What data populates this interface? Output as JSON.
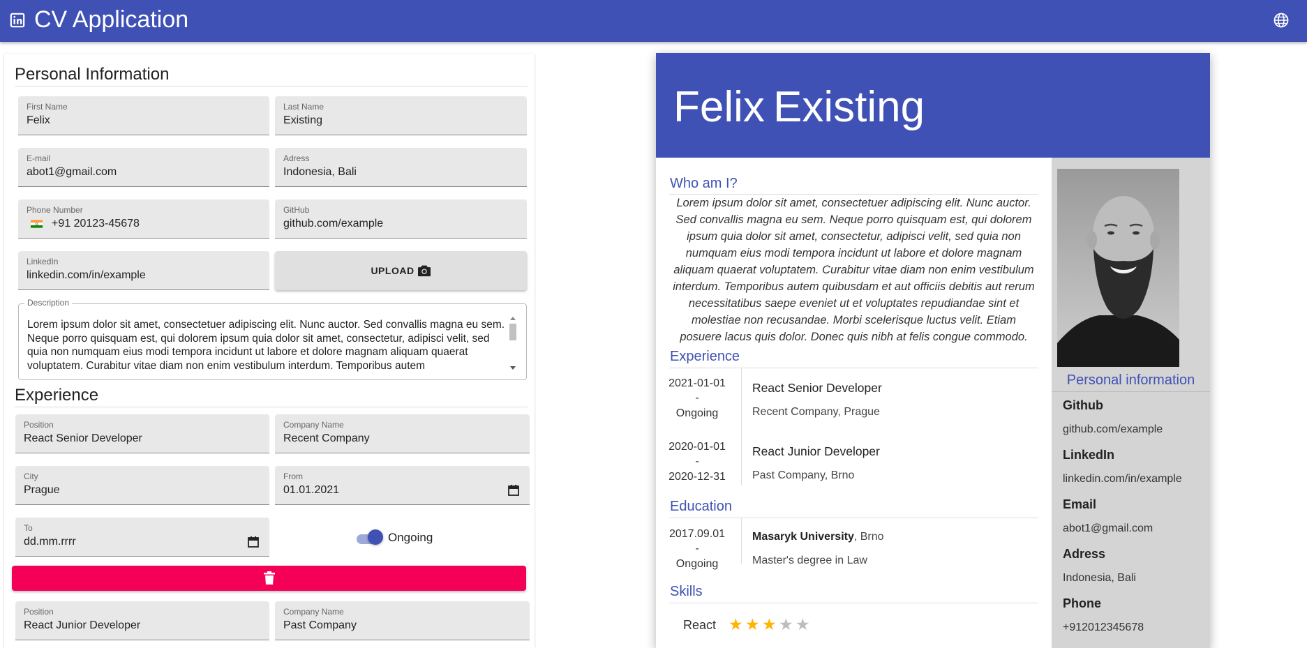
{
  "app": {
    "title": "CV Application"
  },
  "form": {
    "personal": {
      "title": "Personal Information",
      "first_name": {
        "label": "First Name",
        "value": "Felix"
      },
      "last_name": {
        "label": "Last Name",
        "value": "Existing"
      },
      "email": {
        "label": "E-mail",
        "value": "abot1@gmail.com"
      },
      "address": {
        "label": "Adress",
        "value": "Indonesia, Bali"
      },
      "phone": {
        "label": "Phone Number",
        "value": "+91 20123-45678",
        "flag": "india-flag-icon"
      },
      "github": {
        "label": "GitHub",
        "value": "github.com/example"
      },
      "linkedin": {
        "label": "LinkedIn",
        "value": "linkedin.com/in/example"
      },
      "upload_label": "UPLOAD",
      "description": {
        "label": "Description",
        "value": "Lorem ipsum dolor sit amet, consectetuer adipiscing elit. Nunc auctor. Sed convallis magna eu sem. Neque porro quisquam est, qui dolorem ipsum quia dolor sit amet, consectetur, adipisci velit, sed quia non numquam eius modi tempora incidunt ut labore et dolore magnam aliquam quaerat voluptatem. Curabitur vitae diam non enim vestibulum interdum. Temporibus autem"
      }
    },
    "experience": {
      "title": "Experience",
      "items": [
        {
          "position": {
            "label": "Position",
            "value": "React Senior Developer"
          },
          "company": {
            "label": "Company Name",
            "value": "Recent Company"
          },
          "city": {
            "label": "City",
            "value": "Prague"
          },
          "from": {
            "label": "From",
            "value": "01.01.2021"
          },
          "to": {
            "label": "To",
            "value": "dd.mm.rrrr"
          },
          "ongoing_label": "Ongoing",
          "ongoing": true
        },
        {
          "position": {
            "label": "Position",
            "value": "React Junior Developer"
          },
          "company": {
            "label": "Company Name",
            "value": "Past Company"
          }
        }
      ]
    }
  },
  "cv": {
    "first_name": "Felix",
    "last_name": "Existing",
    "about_title": "Who am I?",
    "about": "Lorem ipsum dolor sit amet, consectetuer adipiscing elit. Nunc auctor. Sed convallis magna eu sem. Neque porro quisquam est, qui dolorem ipsum quia dolor sit amet, consectetur, adipisci velit, sed quia non numquam eius modi tempora incidunt ut labore et dolore magnam aliquam quaerat voluptatem. Curabitur vitae diam non enim vestibulum interdum. Temporibus autem quibusdam et aut officiis debitis aut rerum necessitatibus saepe eveniet ut et voluptates repudiandae sint et molestiae non recusandae. Morbi scelerisque luctus velit. Etiam posuere lacus quis dolor. Donec quis nibh at felis congue commodo.",
    "experience_title": "Experience",
    "experience": [
      {
        "from": "2021-01-01",
        "sep": "-",
        "to": "Ongoing",
        "title": "React Senior Developer",
        "place": "Recent Company, Prague"
      },
      {
        "from": "2020-01-01",
        "sep": "-",
        "to": "2020-12-31",
        "title": "React Junior Developer",
        "place": "Past Company, Brno"
      }
    ],
    "education_title": "Education",
    "education": [
      {
        "from": "2017.09.01",
        "sep": "-",
        "to": "Ongoing",
        "school": "Masaryk University",
        "city": ", Brno",
        "degree": "Master's degree in Law"
      }
    ],
    "skills_title": "Skills",
    "skills": [
      {
        "name": "React",
        "rating": 3,
        "max": 5
      }
    ],
    "personal_title": "Personal information",
    "personal": [
      {
        "label": "Github",
        "value": "github.com/example"
      },
      {
        "label": "LinkedIn",
        "value": "linkedin.com/in/example"
      },
      {
        "label": "Email",
        "value": "abot1@gmail.com"
      },
      {
        "label": "Adress",
        "value": "Indonesia, Bali"
      },
      {
        "label": "Phone",
        "value": "+912012345678"
      }
    ]
  },
  "colors": {
    "primary": "#3f51b5",
    "accent": "#f50057",
    "star": "#ffb400",
    "star_empty": "#bdbdbd",
    "sidebar": "#d4d4d4"
  }
}
